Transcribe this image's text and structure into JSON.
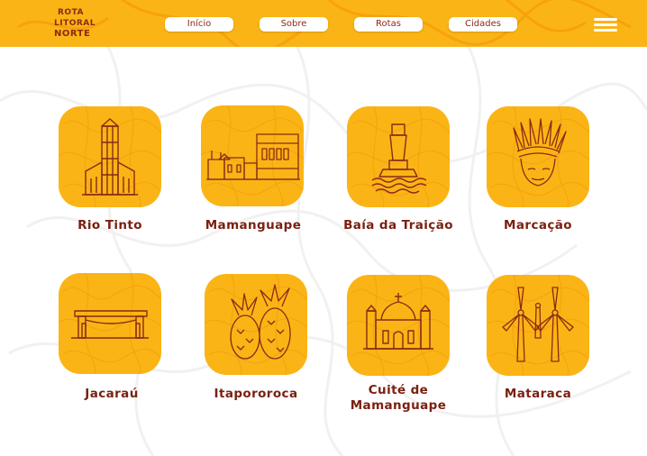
{
  "header": {
    "logo_lines": [
      "ROTA",
      "LITORAL",
      "NORTE"
    ],
    "nav": [
      "Início",
      "Sobre",
      "Rotas",
      "Cidades"
    ],
    "menu_icon": "hamburger-menu-icon"
  },
  "colors": {
    "accent": "#FBB415",
    "brand": "#8A2A16",
    "text": "#7A2010"
  },
  "cities": [
    {
      "name": "Rio Tinto",
      "icon": "factory-tower-icon"
    },
    {
      "name": "Mamanguape",
      "icon": "colonial-buildings-icon"
    },
    {
      "name": "Baía da Traição",
      "icon": "lighthouse-icon"
    },
    {
      "name": "Marcação",
      "icon": "indigenous-headdress-icon"
    },
    {
      "name": "Jacaraú",
      "icon": "city-gate-icon"
    },
    {
      "name": "Itapororoca",
      "icon": "pineapple-icon"
    },
    {
      "name": "Cuité de Mamanguape",
      "icon": "church-icon"
    },
    {
      "name": "Mataraca",
      "icon": "wind-turbines-icon"
    }
  ]
}
